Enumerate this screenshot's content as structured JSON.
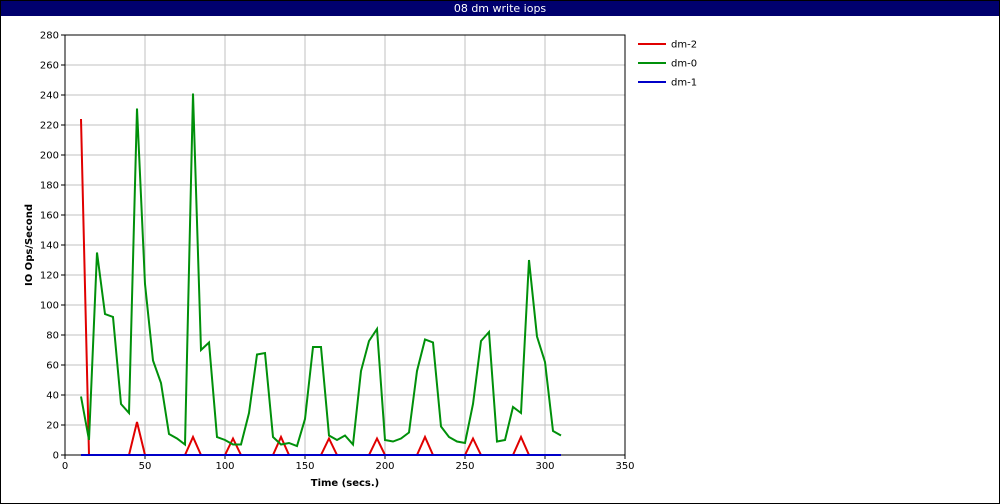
{
  "window": {
    "title": "08 dm write iops"
  },
  "chart_data": {
    "type": "line",
    "title": "08 dm write iops",
    "xlabel": "Time (secs.)",
    "ylabel": "IO Ops/Second",
    "xlim": [
      0,
      350
    ],
    "ylim": [
      0,
      280
    ],
    "xticks": [
      0,
      50,
      100,
      150,
      200,
      250,
      300,
      350
    ],
    "yticks": [
      0,
      20,
      40,
      60,
      80,
      100,
      120,
      140,
      160,
      180,
      200,
      220,
      240,
      260,
      280
    ],
    "grid": true,
    "legend_position": "right",
    "x": [
      10,
      15,
      20,
      25,
      30,
      35,
      40,
      45,
      50,
      55,
      60,
      65,
      70,
      75,
      80,
      85,
      90,
      95,
      100,
      105,
      110,
      115,
      120,
      125,
      130,
      135,
      140,
      145,
      150,
      155,
      160,
      165,
      170,
      175,
      180,
      185,
      190,
      195,
      200,
      205,
      210,
      215,
      220,
      225,
      230,
      235,
      240,
      245,
      250,
      255,
      260,
      265,
      270,
      275,
      280,
      285,
      290,
      295,
      300,
      305,
      310
    ],
    "series": [
      {
        "name": "dm-2",
        "color": "#e00000",
        "values": [
          224,
          0,
          0,
          0,
          0,
          0,
          0,
          22,
          0,
          0,
          0,
          0,
          0,
          0,
          12,
          0,
          0,
          0,
          0,
          11,
          0,
          0,
          0,
          0,
          0,
          12,
          0,
          0,
          0,
          0,
          0,
          11,
          0,
          0,
          0,
          0,
          0,
          11,
          0,
          0,
          0,
          0,
          0,
          12,
          0,
          0,
          0,
          0,
          0,
          11,
          0,
          0,
          0,
          0,
          0,
          12,
          0,
          0,
          0,
          0,
          0
        ]
      },
      {
        "name": "dm-0",
        "color": "#00900a",
        "values": [
          39,
          10,
          135,
          94,
          92,
          34,
          28,
          231,
          114,
          63,
          48,
          14,
          11,
          7,
          241,
          70,
          75,
          12,
          10,
          7,
          7,
          28,
          67,
          68,
          12,
          7,
          8,
          6,
          24,
          72,
          72,
          13,
          10,
          13,
          7,
          56,
          76,
          84,
          10,
          9,
          11,
          15,
          56,
          77,
          75,
          19,
          12,
          9,
          8,
          34,
          76,
          82,
          9,
          10,
          32,
          28,
          130,
          79,
          62,
          16,
          13
        ]
      },
      {
        "name": "dm-1",
        "color": "#0000c8",
        "values": [
          0,
          0,
          0,
          0,
          0,
          0,
          0,
          0,
          0,
          0,
          0,
          0,
          0,
          0,
          0,
          0,
          0,
          0,
          0,
          0,
          0,
          0,
          0,
          0,
          0,
          0,
          0,
          0,
          0,
          0,
          0,
          0,
          0,
          0,
          0,
          0,
          0,
          0,
          0,
          0,
          0,
          0,
          0,
          0,
          0,
          0,
          0,
          0,
          0,
          0,
          0,
          0,
          0,
          0,
          0,
          0,
          0,
          0,
          0,
          0,
          0
        ]
      }
    ]
  }
}
